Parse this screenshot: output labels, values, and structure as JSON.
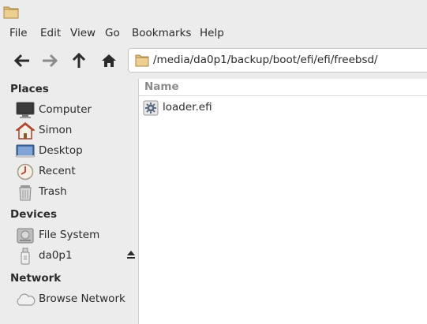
{
  "window": {
    "icon": "folder-icon"
  },
  "menu": [
    "File",
    "Edit",
    "View",
    "Go",
    "Bookmarks",
    "Help"
  ],
  "toolbar": {
    "back": "arrow-left-icon",
    "forward": "arrow-right-icon",
    "up": "arrow-up-icon",
    "home": "home-icon",
    "location": "/media/da0p1/backup/boot/efi/efi/freebsd/"
  },
  "sidebar": {
    "places_title": "Places",
    "places": [
      "Computer",
      "Simon",
      "Desktop",
      "Recent",
      "Trash"
    ],
    "devices_title": "Devices",
    "devices": [
      "File System",
      "da0p1"
    ],
    "network_title": "Network",
    "network": [
      "Browse Network"
    ]
  },
  "main": {
    "column_name": "Name",
    "files": [
      {
        "name": "loader.efi",
        "icon": "executable-gear-icon"
      }
    ]
  },
  "colors": {
    "accent": "#e8b84a",
    "background": "#ececec"
  }
}
